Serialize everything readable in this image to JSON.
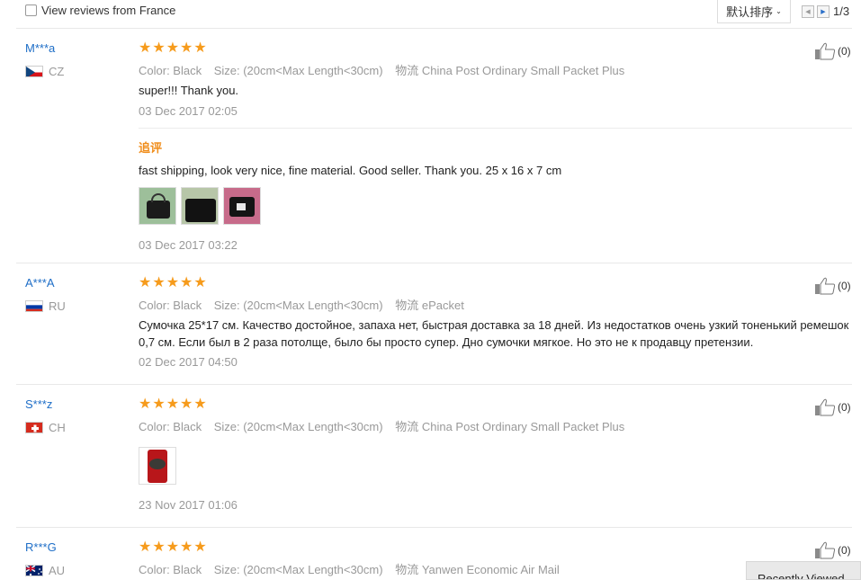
{
  "filter": {
    "label": "View reviews from France",
    "checked": false
  },
  "sort": {
    "label": "默认排序"
  },
  "pager": {
    "page": "1/3"
  },
  "recent_viewed": "Recently Viewed",
  "reviews": [
    {
      "user": "M***a",
      "country": "CZ",
      "stars": "★★★★★",
      "color": "Color: Black",
      "size": "Size: (20cm<Max Length<30cm)",
      "shipping_label": "物流",
      "shipping": "China Post Ordinary Small Packet Plus",
      "text": "super!!! Thank you.",
      "date": "03 Dec 2017 02:05",
      "likes": "(0)",
      "append_label": "追评",
      "append_text": "fast shipping, look very nice, fine material. Good seller. Thank you. 25 x 16 x 7 cm",
      "append_date": "03 Dec 2017 03:22"
    },
    {
      "user": "A***A",
      "country": "RU",
      "stars": "★★★★★",
      "color": "Color: Black",
      "size": "Size: (20cm<Max Length<30cm)",
      "shipping_label": "物流",
      "shipping": "ePacket",
      "text": "Сумочка 25*17 см. Качество достойное, запаха нет, быстрая доставка за 18 дней. Из недостатков очень узкий тоненький ремешок 0,7 см. Если был в 2 раза потолще, было бы просто супер. Дно сумочки мягкое. Но это не к продавцу претензии.",
      "date": "02 Dec 2017 04:50",
      "likes": "(0)"
    },
    {
      "user": "S***z",
      "country": "CH",
      "stars": "★★★★★",
      "color": "Color: Black",
      "size": "Size: (20cm<Max Length<30cm)",
      "shipping_label": "物流",
      "shipping": "China Post Ordinary Small Packet Plus",
      "date": "23 Nov 2017 01:06",
      "likes": "(0)"
    },
    {
      "user": "R***G",
      "country": "AU",
      "stars": "★★★★★",
      "color": "Color: Black",
      "size": "Size: (20cm<Max Length<30cm)",
      "shipping_label": "物流",
      "shipping": "Yanwen Economic Air Mail",
      "likes": "(0)"
    }
  ]
}
